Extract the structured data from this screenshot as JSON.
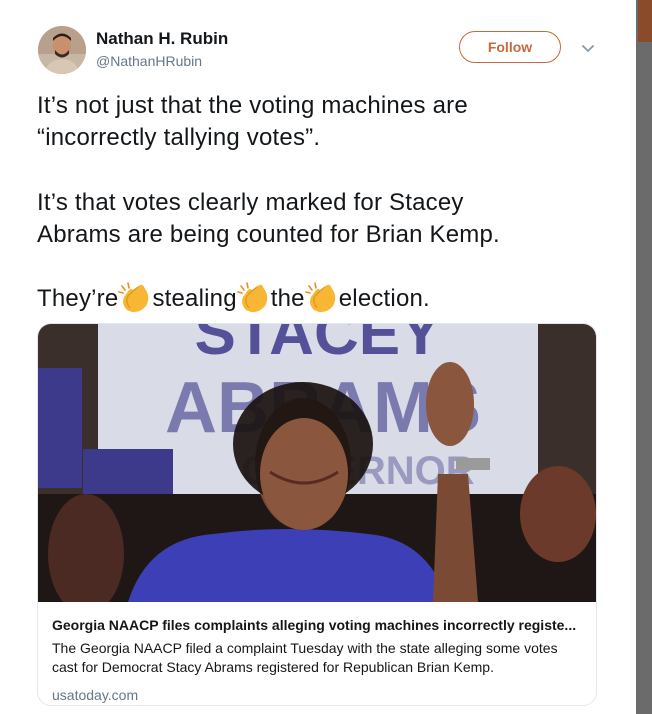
{
  "author": {
    "name": "Nathan H. Rubin",
    "handle": "@NathanHRubin"
  },
  "follow_label": "Follow",
  "tweet": {
    "line1": "It’s not just that the voting machines are",
    "line2": "“incorrectly tallying votes”.",
    "line3": "It’s that votes clearly marked for Stacey",
    "line4": "Abrams are being counted for Brian Kemp.",
    "line5_parts": [
      "They’re",
      "stealing",
      "the",
      "election."
    ]
  },
  "card": {
    "photo_sign_text": [
      "STACEY",
      "ABRAMS",
      "GOVERNOR"
    ],
    "title": "Georgia NAACP files complaints alleging voting machines incorrectly registe...",
    "description": "The Georgia NAACP filed a complaint Tuesday with the state alleging some votes cast for Democrat Stacy Abrams registered for Republican Brian Kemp.",
    "domain": "usatoday.com"
  },
  "colors": {
    "follow_accent": "#c36a3f",
    "secondary_text": "#657786",
    "sign_blue": "#3d3a8c"
  },
  "icons": [
    "chevron-down-icon",
    "clapping-hands-icon"
  ]
}
